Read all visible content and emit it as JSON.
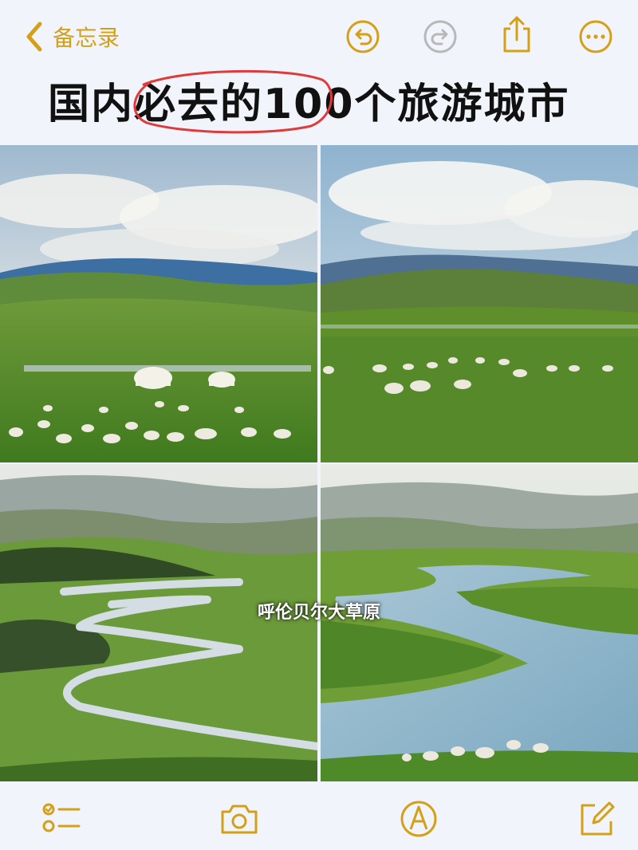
{
  "nav": {
    "back_label": "备忘录"
  },
  "toolbar": {
    "icons": [
      "undo-icon",
      "redo-icon",
      "share-icon",
      "more-icon"
    ]
  },
  "note": {
    "title": "国内必去的100个旅游城市",
    "caption": "呼伦贝尔大草原"
  },
  "bottom_toolbar": {
    "icons": [
      "checklist-icon",
      "camera-icon",
      "markup-icon",
      "compose-icon"
    ]
  },
  "colors": {
    "accent": "#d4a017",
    "annotation": "#e03b3b",
    "background": "#f1f4fb"
  }
}
